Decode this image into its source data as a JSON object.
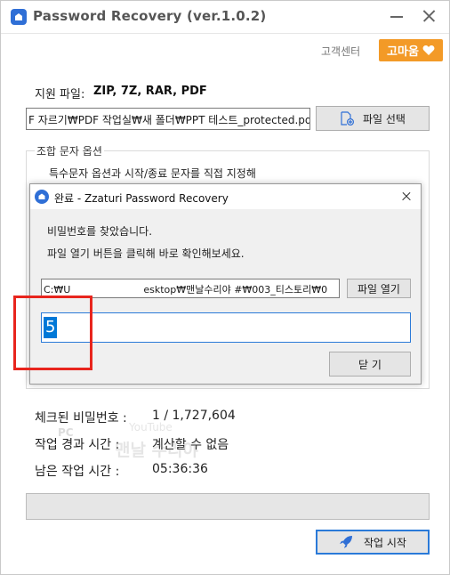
{
  "app": {
    "title": "Password Recovery (ver.1.0.2)"
  },
  "header": {
    "support_link": "고객센터",
    "thanks_button": "고마움"
  },
  "support": {
    "label": "지원 파일:",
    "value": "ZIP, 7Z, RAR, PDF"
  },
  "file": {
    "path": "F 자르기₩PDF 작업실₩새 폴더₩PPT 테스트_protected.pdf",
    "select_button": "파일 선택"
  },
  "combo": {
    "title": "조합 문자 옵션",
    "description": "특수문자 옵션과 시작/종료 문자를 직접 지정해"
  },
  "stats": {
    "checked_label": "체크된 비밀번호 :",
    "checked_value": "1 / 1,727,604",
    "elapsed_label": "작업 경과 시간 :",
    "elapsed_value": "계산할 수 없음",
    "remaining_label": "남은 작업 시간 :",
    "remaining_value": "05:36:36"
  },
  "start_button": "작업 시작",
  "watermark": {
    "pc": "PC",
    "youtube": "YouTube",
    "name": "맨날 수리야"
  },
  "dialog": {
    "title": "완료 - Zzaturi Password Recovery",
    "message1": "비밀번호를 찾았습니다.",
    "message2": "파일 열기 버튼을 클릭해 바로 확인해보세요.",
    "path_start": "C:₩U",
    "path_end": "esktop₩맨날수리야 #₩003_티스토리₩0",
    "open_button": "파일 열기",
    "password": "5",
    "ok_button": "닫 기"
  },
  "colors": {
    "accent": "#f39a27",
    "focus": "#2a7ad8",
    "highlight": "#e8251d",
    "selection": "#0078d7"
  }
}
